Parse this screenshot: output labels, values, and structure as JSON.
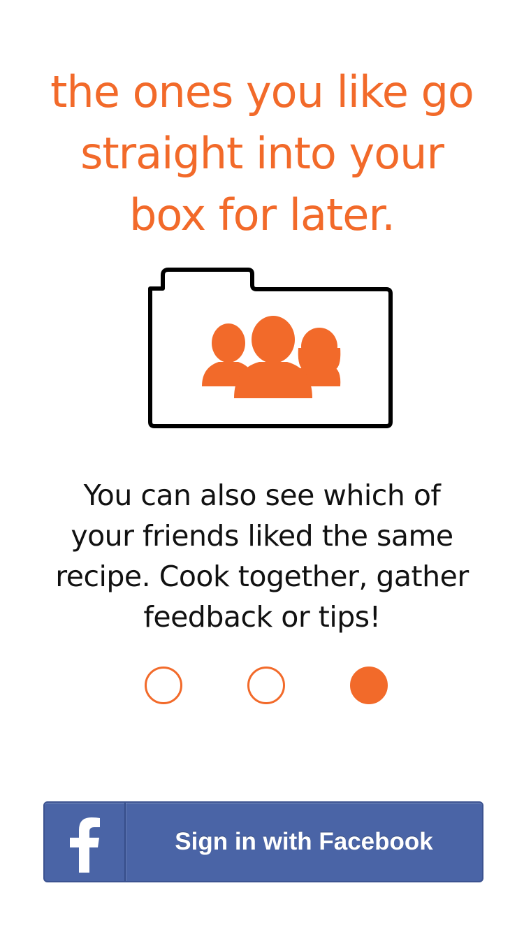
{
  "onboarding": {
    "headline_lines": [
      "the ones you like go",
      "straight into your",
      "box for later."
    ],
    "illustration_icon": "folder-with-people-icon",
    "description_lines": [
      "You can also see which of",
      "your friends liked the same",
      "recipe. Cook together, gather",
      "feedback or tips!"
    ],
    "pager": {
      "total": 3,
      "current": 3
    },
    "facebook_button": {
      "label": "Sign in with Facebook",
      "icon": "facebook-f-icon"
    }
  },
  "colors": {
    "accent": "#f26a2a",
    "facebook_blue": "#4a64a6",
    "text": "#111111",
    "background": "#ffffff"
  }
}
